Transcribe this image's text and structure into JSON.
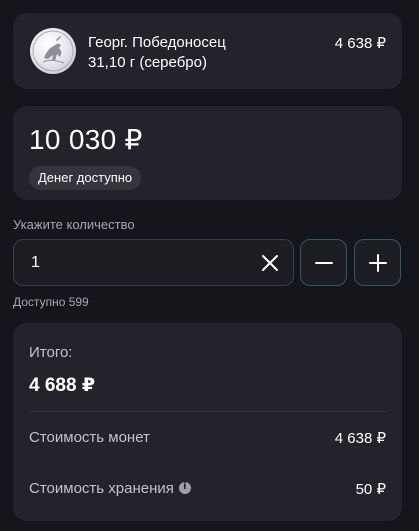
{
  "coin": {
    "name": "Георг. Победоносец",
    "weight": "31,10 г (серебро)",
    "price": "4 638 ₽",
    "image_icon": "coin-saint-george-icon"
  },
  "balance": {
    "amount": "10 030 ₽",
    "badge": "Денег доступно"
  },
  "quantity": {
    "label": "Укажите количество",
    "value": "1",
    "available": "Доступно 599"
  },
  "summary": {
    "total_label": "Итого:",
    "total_value": "4 688 ₽",
    "coins_cost_label": "Стоимость монет",
    "coins_cost_value": "4 638 ₽",
    "storage_cost_label": "Стоимость хранения",
    "storage_cost_value": "50 ₽"
  },
  "colors": {
    "background": "#15161b",
    "card": "#23242b",
    "accent_border": "#2e5c56"
  }
}
